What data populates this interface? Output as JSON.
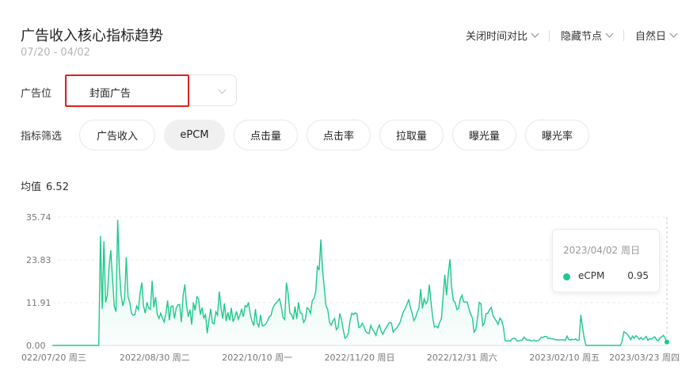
{
  "header": {
    "title": "广告收入核心指标趋势",
    "date_range": "07/20 - 04/02",
    "actions": [
      {
        "label": "关闭时间对比"
      },
      {
        "label": "隐藏节点"
      },
      {
        "label": "自然日"
      }
    ]
  },
  "ad_slot": {
    "label": "广告位",
    "selected": "封面广告"
  },
  "filters": {
    "label": "指标筛选",
    "chips": [
      "广告收入",
      "ePCM",
      "点击量",
      "点击率",
      "拉取量",
      "曝光量",
      "曝光率"
    ],
    "active": "ePCM"
  },
  "average": {
    "label": "均值",
    "value": "6.52"
  },
  "tooltip": {
    "date": "2023/04/02 周日",
    "series_name": "eCPM",
    "value": "0.95"
  },
  "colors": {
    "line": "#1ec98a",
    "highlight": "#e02020"
  },
  "chart_data": {
    "type": "area",
    "y_ticks": [
      "35.74",
      "23.83",
      "11.91",
      "0.00"
    ],
    "ylim": [
      0,
      35.74
    ],
    "x_tick_labels": [
      "022/07/20 周三",
      "2022/08/30 周二",
      "2022/10/10 周一",
      "2022/11/20 周日",
      "2022/12/31 周六",
      "2023/02/10 周五",
      "2023/03/23 周四"
    ],
    "grid": true,
    "series": [
      {
        "name": "eCPM",
        "values": [
          0,
          0,
          0,
          0,
          0,
          0,
          0,
          0,
          0,
          0,
          0,
          0,
          0,
          0,
          0,
          0,
          0,
          0,
          0,
          0,
          0,
          0,
          0,
          0,
          0,
          0,
          0,
          0,
          30.5,
          10.2,
          29,
          12,
          14,
          22,
          26.5,
          18.6,
          11,
          9.4,
          35,
          21,
          14,
          11,
          13,
          24.6,
          13.6,
          12,
          9,
          8.4,
          8.6,
          11,
          10,
          14.5,
          17.5,
          11,
          9,
          12,
          10.5,
          10,
          18,
          10.6,
          13.5,
          8.6,
          7.5,
          9,
          7.6,
          6.5,
          8.9,
          12.5,
          7,
          10.8,
          11,
          7.5,
          10.5,
          11.3,
          11.4,
          6.5,
          14,
          17,
          11,
          8,
          10,
          5.8,
          12,
          9.7,
          13.5,
          13,
          8.6,
          10.5,
          7.6,
          8.6,
          3.4,
          7,
          10.2,
          6.3,
          6,
          9.4,
          8.4,
          15,
          10.4,
          7.5,
          11.7,
          6.8,
          9.2,
          7,
          10.5,
          6.6,
          7.8,
          9.5,
          7.3,
          8.4,
          10.2,
          8,
          11.1,
          10.7,
          12,
          8.6,
          6.8,
          5.5,
          10.1,
          6.2,
          5.2,
          8.5,
          5.4,
          5.6,
          6,
          6.8,
          8,
          8.3,
          10.2,
          11.3,
          11.8,
          12.4,
          13,
          10.8,
          7.8,
          7.2,
          17.5,
          14.5,
          9,
          8.6,
          7.2,
          10.8,
          7.4,
          12,
          9.1,
          8.9,
          6.4,
          7.2,
          10.5,
          10.1,
          8.9,
          12.5,
          13,
          15,
          22,
          21,
          29.5,
          21,
          16,
          11,
          10,
          6.5,
          5.6,
          6.8,
          7.5,
          4.4,
          5,
          8.9,
          7.2,
          4.4,
          2,
          2.4,
          3.5,
          7,
          9,
          8.6,
          9.1,
          8.8,
          5,
          5.2,
          6.2,
          5.3,
          4,
          3.5,
          3.3,
          5.6,
          4.5,
          3.8,
          2.8,
          4.7,
          5.7,
          4,
          3.1,
          4.2,
          5,
          5.8,
          6.4,
          6.2,
          3.7,
          4.4,
          4.8,
          5.5,
          6.4,
          8,
          9.5,
          10.2,
          11.5,
          12.7,
          10.7,
          9,
          6.9,
          7.7,
          9.3,
          10.4,
          15.7,
          10.3,
          13,
          11.6,
          12.3,
          16.9,
          12,
          7.6,
          5.1,
          5.3,
          4.9,
          6.4,
          7.4,
          13.5,
          19.7,
          14,
          20,
          24,
          16,
          12.5,
          12,
          10,
          10.3,
          13,
          14,
          12.1,
          12.1,
          12.1,
          10.3,
          8.7,
          7.7,
          3.7,
          4.4,
          7.6,
          12,
          11.6,
          5.5,
          6.2,
          8.9,
          9,
          10,
          10.6,
          8.3,
          7.5,
          6.7,
          5.9,
          7.6,
          7,
          5.2,
          1.4,
          1.2,
          1.3,
          1.2,
          1.8,
          2,
          1.9,
          1.2,
          1.3,
          1.4,
          1.5,
          2.3,
          1.8,
          1.4,
          1.6,
          1.3,
          1.3,
          1.5,
          1.2,
          1.3,
          1.6,
          2.3,
          2.2,
          2.5,
          2.5,
          1.9,
          2,
          1.8,
          1.8,
          1.6,
          1.6,
          1.5,
          1.6,
          1.5,
          1.6,
          1.4,
          2.6,
          1.6,
          1.5,
          1.7,
          1.6,
          1.8,
          1.4,
          1.5,
          8.5,
          5,
          2,
          0,
          0,
          0,
          0,
          0,
          0,
          0,
          0,
          0,
          0,
          0,
          0,
          0,
          0,
          0,
          0,
          0,
          0,
          0,
          0,
          0,
          1.2,
          3.8,
          3.5,
          3.2,
          2.4,
          1.6,
          2.6,
          2,
          2.7,
          2.3,
          1.7,
          2.2,
          1.6,
          2,
          2.5,
          1.4,
          1.9,
          1.8,
          2.1,
          2.4,
          1.5,
          1.3,
          2.1,
          2.4,
          2.8,
          2,
          0.95
        ]
      }
    ]
  }
}
